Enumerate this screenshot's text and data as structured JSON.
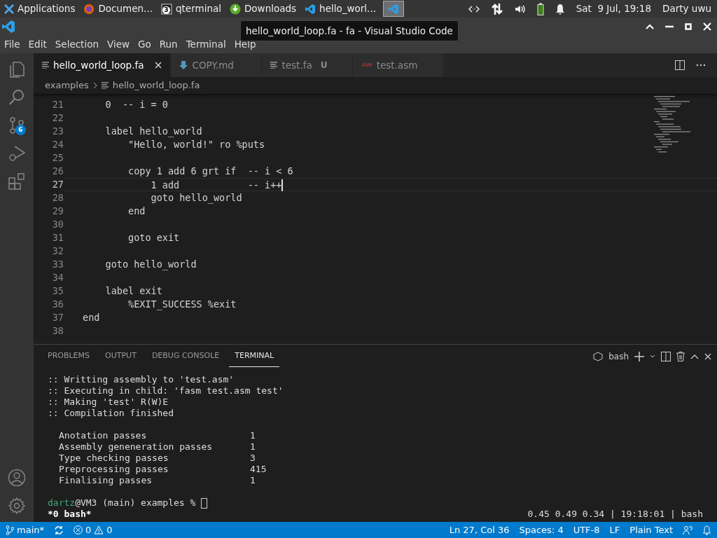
{
  "taskbar": {
    "items": [
      {
        "kind": "apps",
        "label": "Applications",
        "selected": false
      },
      {
        "kind": "firefox",
        "label": "Documen...",
        "selected": false
      },
      {
        "kind": "terminal",
        "label": "qterminal",
        "badge": "3",
        "selected": false
      },
      {
        "kind": "download",
        "label": "Downloads",
        "selected": false
      },
      {
        "kind": "vscode",
        "label": "hello_worl...",
        "selected": false
      },
      {
        "kind": "vscode",
        "selected": true
      }
    ],
    "clock": "Sat  9 Jul, 19:18",
    "user": "Darty uwu"
  },
  "tooltip": "hello_world_loop.fa - fa - Visual Studio Code",
  "menu": [
    "File",
    "Edit",
    "Selection",
    "View",
    "Go",
    "Run",
    "Terminal",
    "Help"
  ],
  "activity_bar": {
    "scm_badge": "6"
  },
  "tabs": [
    {
      "kind": "text",
      "label": "hello_world_loop.fa",
      "selected": true
    },
    {
      "kind": "markdown",
      "label": "COPY.md",
      "selected": false
    },
    {
      "kind": "text",
      "label": "test.fa",
      "status": "U",
      "selected": false
    },
    {
      "kind": "asm",
      "icon_text": "ASM",
      "label": "test.asm",
      "selected": false
    }
  ],
  "breadcrumbs": [
    "examples",
    "hello_world_loop.fa"
  ],
  "editor": {
    "lines": [
      {
        "number": "21",
        "text": "    0  -- i = 0",
        "current": false
      },
      {
        "number": "22",
        "current": false
      },
      {
        "number": "23",
        "text": "    label hello_world",
        "current": false
      },
      {
        "number": "24",
        "text": "        \"Hello, world!\" ro %puts",
        "current": false
      },
      {
        "number": "25",
        "current": false
      },
      {
        "number": "26",
        "text": "        copy 1 add 6 grt if  -- i < 6",
        "current": false
      },
      {
        "number": "27",
        "text": "            1 add            -- i++",
        "current": true
      },
      {
        "number": "28",
        "text": "            goto hello_world",
        "current": false
      },
      {
        "number": "29",
        "text": "        end",
        "current": false
      },
      {
        "number": "30",
        "current": false
      },
      {
        "number": "31",
        "text": "        goto exit",
        "current": false
      },
      {
        "number": "32",
        "current": false
      },
      {
        "number": "33",
        "text": "    goto hello_world",
        "current": false
      },
      {
        "number": "34",
        "current": false
      },
      {
        "number": "35",
        "text": "    label exit",
        "current": false
      },
      {
        "number": "36",
        "text": "        %EXIT_SUCCESS %exit",
        "current": false
      },
      {
        "number": "37",
        "text": "end",
        "current": false
      },
      {
        "number": "38",
        "current": false
      }
    ]
  },
  "panel": {
    "tabs": [
      {
        "label": "PROBLEMS",
        "selected": false
      },
      {
        "label": "OUTPUT",
        "selected": false
      },
      {
        "label": "DEBUG CONSOLE",
        "selected": false
      },
      {
        "label": "TERMINAL",
        "selected": true
      }
    ],
    "shell": "bash",
    "lines": [
      ":: Writting assembly to 'test.asm'",
      ":: Executing in child: 'fasm test.asm test'",
      ":: Making 'test' R(W)E",
      ":: Compilation finished"
    ],
    "stats": [
      {
        "label": "Anotation passes",
        "value": "1"
      },
      {
        "label": "Assembly geneneration passes",
        "value": "1"
      },
      {
        "label": "Type checking passes",
        "value": "3"
      },
      {
        "label": "Preprocessing passes",
        "value": "415"
      },
      {
        "label": "Finalising passes",
        "value": "1"
      }
    ],
    "prompt": {
      "user": "dartz",
      "rest": "@VM3 (main) examples % "
    },
    "tmux_left": "*0 bash*",
    "tmux_right": "0.45 0.49 0.34 | 19:18:01 | bash"
  },
  "status_bar": {
    "branch": "main*",
    "errors": "0",
    "warnings": "0",
    "right": [
      "Ln 27, Col 36",
      "Spaces: 4",
      "UTF-8",
      "LF",
      "Plain Text"
    ]
  }
}
